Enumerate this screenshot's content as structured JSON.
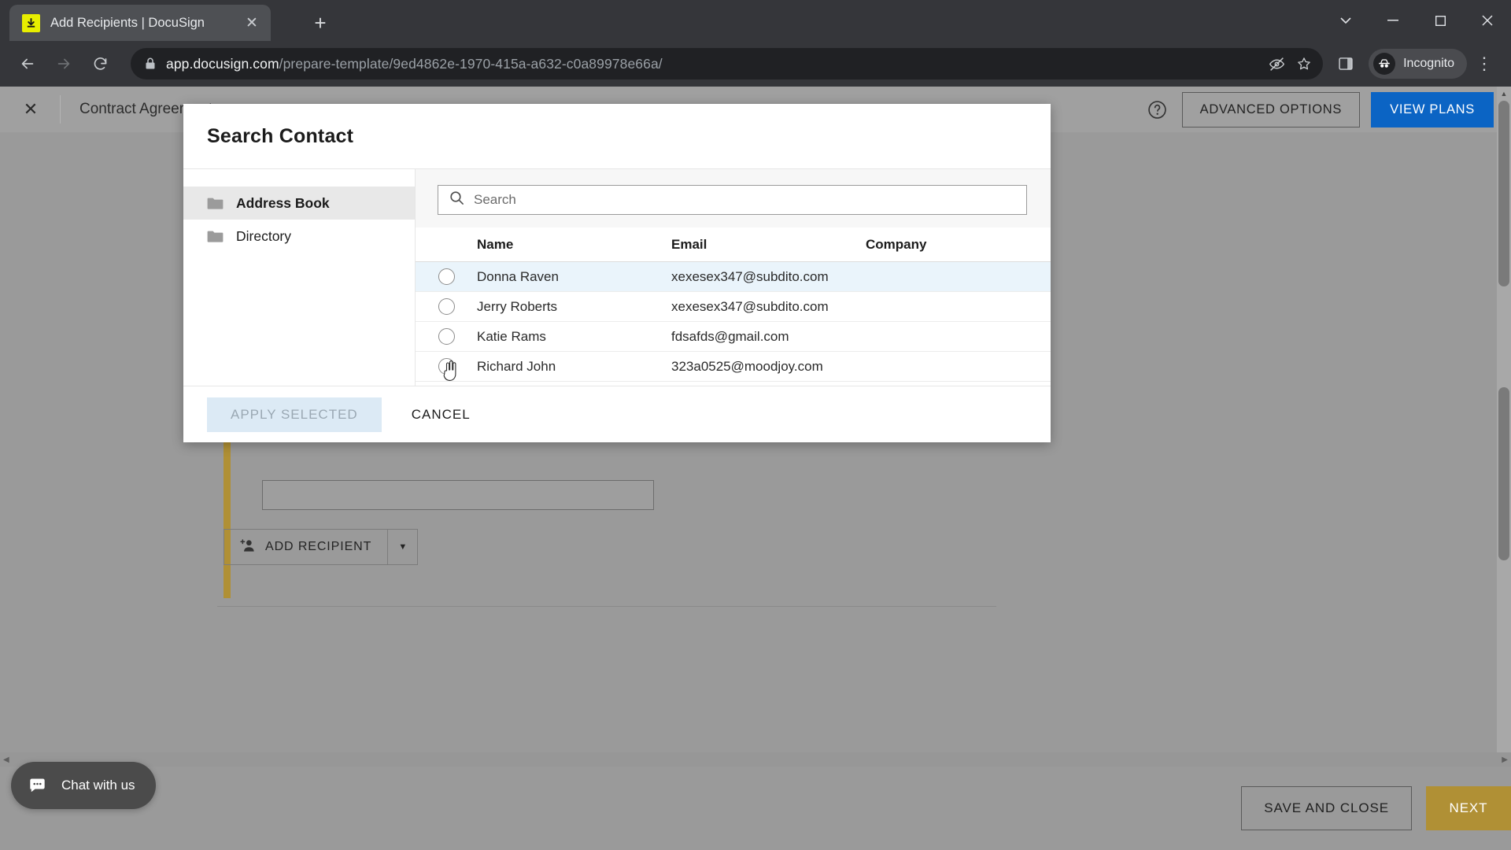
{
  "browser": {
    "tab": {
      "title": "Add Recipients | DocuSign",
      "favicon_icon": "docusign-download-icon",
      "close_icon": "close-icon"
    },
    "new_tab_icon": "plus-icon",
    "window_controls": {
      "minimize_icon": "chevron-down-icon",
      "minimize2_icon": "minimize-icon",
      "maximize_icon": "maximize-icon",
      "close_icon": "close-icon"
    },
    "nav": {
      "back_icon": "arrow-left-icon",
      "forward_icon": "arrow-right-icon",
      "reload_icon": "reload-icon"
    },
    "omnibox": {
      "lock_icon": "lock-icon",
      "url_host": "app.docusign.com",
      "url_path": "/prepare-template/9ed4862e-1970-415a-a632-c0a89978e66a/",
      "cookie_icon": "third-party-cookie-blocked-icon",
      "bookmark_icon": "star-icon"
    },
    "side_panel_icon": "side-panel-icon",
    "profile": {
      "label": "Incognito",
      "icon": "incognito-icon"
    },
    "menu_icon": "three-dots-menu-icon"
  },
  "ds_header": {
    "close_icon": "close-icon",
    "doc_title": "Contract Agreement",
    "help_icon": "help-circle-icon",
    "advanced_options": "ADVANCED OPTIONS",
    "view_plans": "VIEW PLANS",
    "view_plans_color": "#0b64c4"
  },
  "page_body": {
    "add_recipient": "ADD RECIPIENT",
    "add_recipient_icon": "add-person-icon",
    "add_recipient_caret_icon": "chevron-down-icon",
    "recipient_accent_color": "#b09035"
  },
  "modal": {
    "title": "Search Contact",
    "sidebar": [
      {
        "label": "Address Book",
        "icon": "folder-icon",
        "active": true
      },
      {
        "label": "Directory",
        "icon": "folder-icon",
        "active": false
      }
    ],
    "search": {
      "placeholder": "Search",
      "value": "",
      "icon": "search-icon"
    },
    "table": {
      "columns": [
        "Name",
        "Email",
        "Company"
      ],
      "rows": [
        {
          "name": "Donna Raven",
          "email": "xexesex347@subdito.com",
          "company": "",
          "selected": false,
          "hovered": true
        },
        {
          "name": "Jerry Roberts",
          "email": "xexesex347@subdito.com",
          "company": "",
          "selected": false,
          "hovered": false
        },
        {
          "name": "Katie Rams",
          "email": "fdsafds@gmail.com",
          "company": "",
          "selected": false,
          "hovered": false
        },
        {
          "name": "Richard John",
          "email": "323a0525@moodjoy.com",
          "company": "",
          "selected": false,
          "hovered": false
        }
      ]
    },
    "footer": {
      "apply_label": "APPLY SELECTED",
      "apply_disabled": true,
      "cancel_label": "CANCEL"
    }
  },
  "ds_footer": {
    "save_and_close": "SAVE AND CLOSE",
    "next": "NEXT",
    "next_color": "#b09035"
  },
  "chat": {
    "label": "Chat with us",
    "icon": "chat-bubble-icon"
  }
}
